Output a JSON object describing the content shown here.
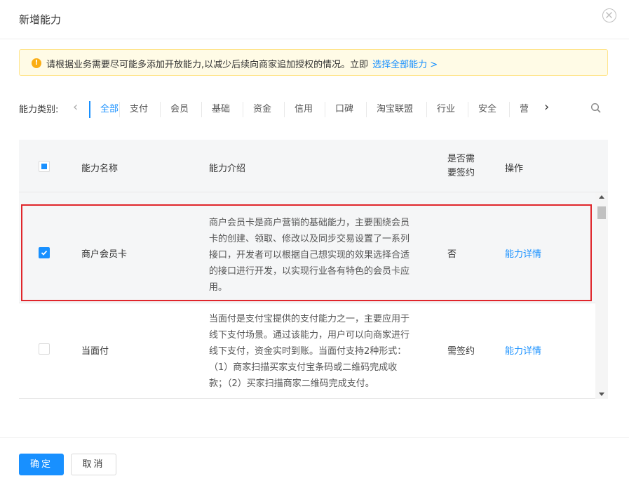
{
  "modal": {
    "title": "新增能力"
  },
  "alert": {
    "text": "请根据业务需要尽可能多添加开放能力,以减少后续向商家追加授权的情况。立即",
    "link_text": "选择全部能力 >"
  },
  "category": {
    "label": "能力类别:",
    "tabs": [
      {
        "label": "全部",
        "active": true
      },
      {
        "label": "支付"
      },
      {
        "label": "会员"
      },
      {
        "label": "基础"
      },
      {
        "label": "资金"
      },
      {
        "label": "信用"
      },
      {
        "label": "口碑"
      },
      {
        "label": "淘宝联盟"
      },
      {
        "label": "行业"
      },
      {
        "label": "安全"
      },
      {
        "label": "营"
      }
    ]
  },
  "table": {
    "headers": {
      "name": "能力名称",
      "intro": "能力介绍",
      "sign_line1": "是否需",
      "sign_line2": "要签约",
      "action": "操作"
    },
    "rows": [
      {
        "checked": true,
        "name": "商户会员卡",
        "desc_lines": [
          "商户会员卡是商户营销的基础能力，主要围绕会员",
          "卡的创建、领取、修改以及同步交易设置了一系列",
          "接口，开发者可以根据自己想实现的效果选择合适",
          "的接口进行开发，以实现行业各有特色的会员卡应",
          "用。"
        ],
        "sign": "否",
        "action": "能力详情"
      },
      {
        "checked": false,
        "name": "当面付",
        "desc_lines": [
          "当面付是支付宝提供的支付能力之一，主要应用于",
          "线下支付场景。通过该能力，用户可以向商家进行",
          "线下支付，资金实时到账。当面付支持2种形式：",
          "（1）商家扫描买家支付宝条码或二维码完成收",
          "款；（2）买家扫描商家二维码完成支付。"
        ],
        "sign": "需签约",
        "action": "能力详情"
      }
    ]
  },
  "footer": {
    "confirm": "确定",
    "cancel": "取消"
  },
  "colors": {
    "accent": "#1890ff",
    "highlight": "#e0262b",
    "alert_bg": "#fffbe6"
  }
}
